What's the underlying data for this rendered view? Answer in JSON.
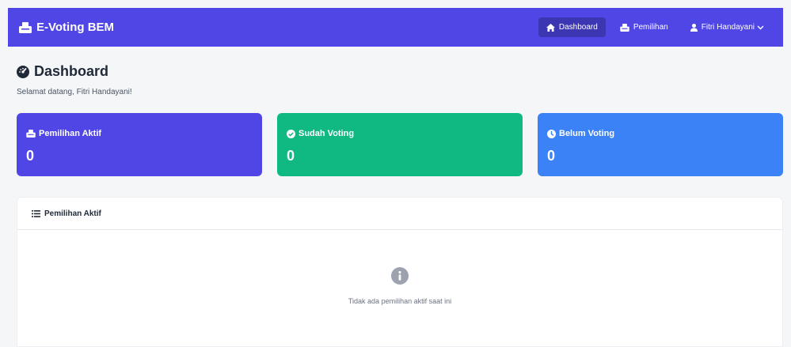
{
  "navbar": {
    "brand": "E-Voting BEM",
    "links": [
      {
        "label": "Dashboard",
        "icon": "home-icon",
        "active": true
      },
      {
        "label": "Pemilihan",
        "icon": "vote-box-icon",
        "active": false
      }
    ],
    "user": {
      "name": "Fitri Handayani",
      "icon": "user-icon"
    }
  },
  "header": {
    "title": "Dashboard",
    "welcome": "Selamat datang, Fitri Handayani!"
  },
  "stats": [
    {
      "label": "Pemilihan Aktif",
      "value": "0",
      "color": "#4f46e5",
      "icon": "vote-box-icon"
    },
    {
      "label": "Sudah Voting",
      "value": "0",
      "color": "#10b981",
      "icon": "check-circle-icon"
    },
    {
      "label": "Belum Voting",
      "value": "0",
      "color": "#3b82f6",
      "icon": "clock-icon"
    }
  ],
  "panel": {
    "title": "Pemilihan Aktif",
    "empty_message": "Tidak ada pemilihan aktif saat ini"
  },
  "colors": {
    "navbar_bg": "#4f46e5",
    "page_bg": "#f5f6f8"
  }
}
